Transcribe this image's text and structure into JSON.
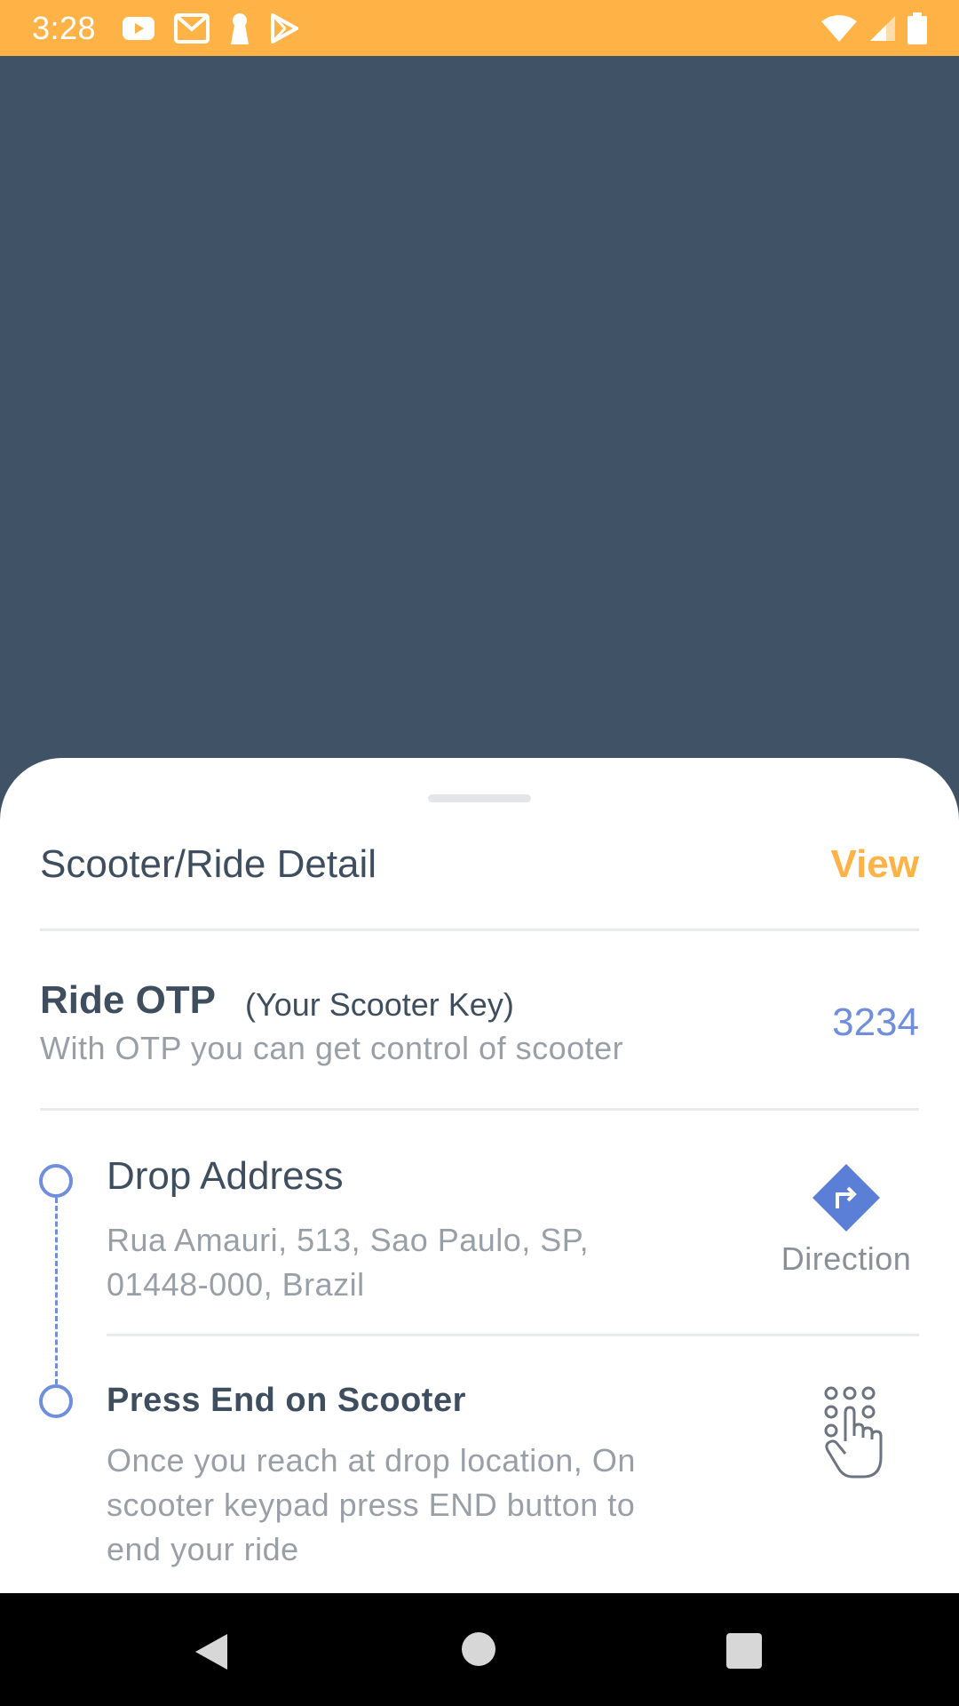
{
  "status_bar": {
    "time": "3:28",
    "background": "#FFB246",
    "icons_left": [
      "youtube-icon",
      "gmail-icon",
      "keyhole-icon",
      "play-store-icon"
    ],
    "icons_right": [
      "wifi-icon",
      "signal-icon",
      "battery-icon"
    ]
  },
  "map": {
    "background": "#405366"
  },
  "sheet": {
    "header": {
      "title": "Scooter/Ride Detail",
      "view_label": "View"
    },
    "otp": {
      "title": "Ride OTP",
      "subtitle": "(Your Scooter Key)",
      "description": "With OTP you can get control of scooter",
      "value": "3234"
    },
    "drop": {
      "title": "Drop Address",
      "address": "Rua Amauri, 513, Sao Paulo, SP, 01448-000, Brazil",
      "direction_label": "Direction",
      "direction_icon": "turn-right-diamond-icon"
    },
    "end_step": {
      "title": "Press End on Scooter",
      "description": "Once you reach at drop location, On scooter keypad press END button to end your ride",
      "icon": "keypad-tap-icon"
    }
  },
  "colors": {
    "accent_orange": "#FFB246",
    "accent_blue": "#6F8EDB",
    "text_dark": "#3F4E5F",
    "text_muted": "#999FA6"
  },
  "nav_bar": {
    "buttons": [
      "back-icon",
      "home-icon",
      "recents-icon"
    ]
  }
}
